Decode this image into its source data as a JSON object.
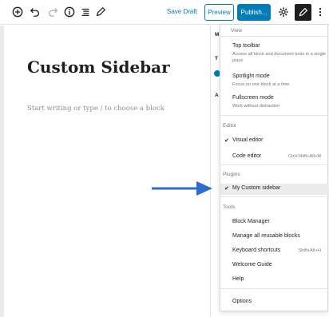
{
  "toolbar": {
    "save_draft": "Save Draft",
    "preview": "Preview",
    "publish": "Publish...",
    "icons": [
      "plus-circle-icon",
      "undo-icon",
      "redo-icon",
      "info-icon",
      "list-view-icon",
      "pencil-tool-icon",
      "gear-icon",
      "edit-active-icon",
      "more-vertical-icon"
    ]
  },
  "post": {
    "title": "Custom Sidebar",
    "placeholder": "Start writing or type / to choose a block"
  },
  "sidebar_strip": {
    "letters": [
      "M",
      "T",
      "A"
    ]
  },
  "menu": {
    "view": {
      "label": "View",
      "items": [
        {
          "title": "Top toolbar",
          "desc": "Access all block and document tools in a single place"
        },
        {
          "title": "Spotlight mode",
          "desc": "Focus on one block at a time"
        },
        {
          "title": "Fullscreen mode",
          "desc": "Work without distraction"
        }
      ]
    },
    "editor": {
      "label": "Editor",
      "items": [
        {
          "title": "Visual editor",
          "checked": true,
          "shortcut": ""
        },
        {
          "title": "Code editor",
          "checked": false,
          "shortcut": "Ctrl+Shift+Alt+M"
        }
      ]
    },
    "plugins": {
      "label": "Plugins",
      "items": [
        {
          "title": "My Custom sidebar",
          "checked": true
        }
      ]
    },
    "tools": {
      "label": "Tools",
      "items": [
        {
          "title": "Block Manager",
          "shortcut": ""
        },
        {
          "title": "Manage all reusable blocks",
          "shortcut": ""
        },
        {
          "title": "Keyboard shortcuts",
          "shortcut": "Shift+Alt+H"
        },
        {
          "title": "Welcome Guide",
          "shortcut": ""
        },
        {
          "title": "Help",
          "shortcut": ""
        }
      ]
    },
    "options": "Options"
  },
  "colors": {
    "accent": "#007cba",
    "arrow": "#2e6bd1",
    "text": "#1e1e1e"
  }
}
